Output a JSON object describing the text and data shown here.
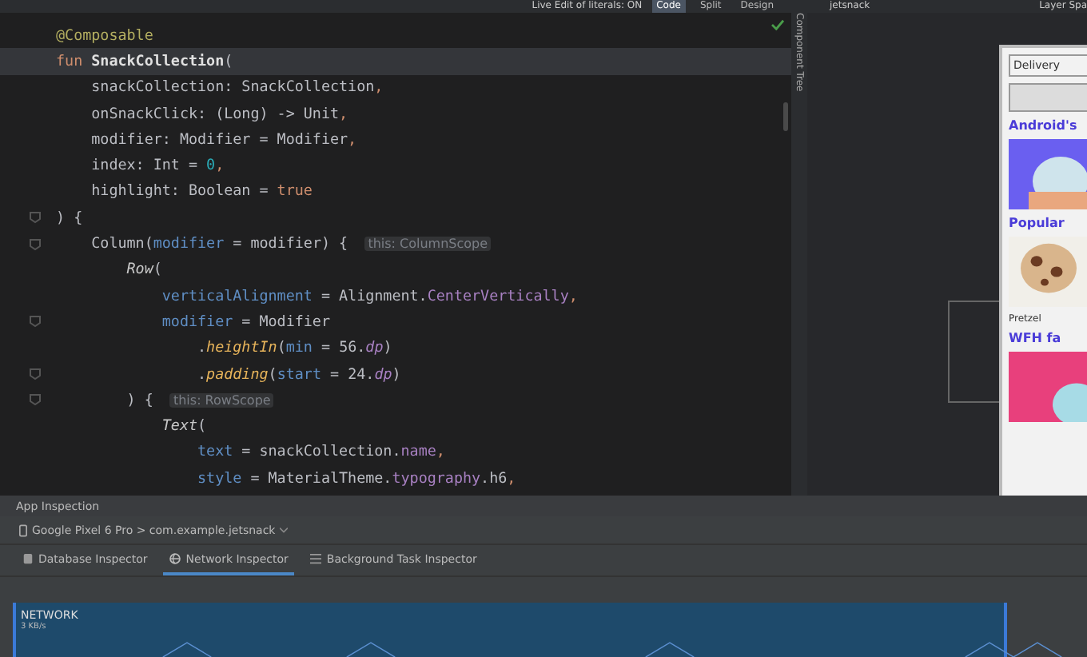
{
  "toolbar": {
    "live_edit": "Live Edit of literals: ON",
    "view_modes": [
      {
        "label": "Code",
        "selected": true
      },
      {
        "label": "Split",
        "selected": false
      },
      {
        "label": "Design",
        "selected": false
      }
    ],
    "device": "jetsnack",
    "layer_label": "Layer Spa"
  },
  "editor": {
    "lines": [
      {
        "fold": false,
        "current": false,
        "tokens": [
          {
            "kind": "annotation",
            "text": "@Composable"
          }
        ]
      },
      {
        "fold": false,
        "current": true,
        "tokens": [
          {
            "kind": "keyword",
            "text": "fun "
          },
          {
            "kind": "decl",
            "text": "SnackCollection"
          },
          {
            "kind": "plain",
            "text": "("
          }
        ]
      },
      {
        "fold": false,
        "current": false,
        "tokens": [
          {
            "kind": "plain",
            "text": "    snackCollection: SnackCollection"
          },
          {
            "kind": "keyword",
            "text": ","
          }
        ]
      },
      {
        "fold": false,
        "current": false,
        "tokens": [
          {
            "kind": "plain",
            "text": "    onSnackClick: (Long) -> Unit"
          },
          {
            "kind": "keyword",
            "text": ","
          }
        ]
      },
      {
        "fold": false,
        "current": false,
        "tokens": [
          {
            "kind": "plain",
            "text": "    modifier: Modifier = Modifier"
          },
          {
            "kind": "keyword",
            "text": ","
          }
        ]
      },
      {
        "fold": false,
        "current": false,
        "tokens": [
          {
            "kind": "plain",
            "text": "    index: Int = "
          },
          {
            "kind": "number",
            "text": "0"
          },
          {
            "kind": "keyword",
            "text": ","
          }
        ]
      },
      {
        "fold": false,
        "current": false,
        "tokens": [
          {
            "kind": "plain",
            "text": "    highlight: Boolean = "
          },
          {
            "kind": "keyword",
            "text": "true"
          }
        ]
      },
      {
        "fold": true,
        "current": false,
        "tokens": [
          {
            "kind": "plain",
            "text": ") {"
          }
        ]
      },
      {
        "fold": true,
        "current": false,
        "tokens": [
          {
            "kind": "plain",
            "text": "    Column("
          },
          {
            "kind": "param",
            "text": "modifier"
          },
          {
            "kind": "plain",
            "text": " = modifier) { "
          },
          {
            "kind": "hint",
            "text": "this: ColumnScope"
          }
        ]
      },
      {
        "fold": false,
        "current": false,
        "tokens": [
          {
            "kind": "call",
            "text": "        Row"
          },
          {
            "kind": "plain",
            "text": "("
          }
        ]
      },
      {
        "fold": false,
        "current": false,
        "tokens": [
          {
            "kind": "param",
            "text": "            verticalAlignment"
          },
          {
            "kind": "plain",
            "text": " = Alignment."
          },
          {
            "kind": "prop",
            "text": "CenterVertically"
          },
          {
            "kind": "keyword",
            "text": ","
          }
        ]
      },
      {
        "fold": true,
        "current": false,
        "tokens": [
          {
            "kind": "param",
            "text": "            modifier"
          },
          {
            "kind": "plain",
            "text": " = Modifier"
          }
        ]
      },
      {
        "fold": false,
        "current": false,
        "tokens": [
          {
            "kind": "plain",
            "text": "                ."
          },
          {
            "kind": "ext",
            "text": "heightIn"
          },
          {
            "kind": "plain",
            "text": "("
          },
          {
            "kind": "param",
            "text": "min"
          },
          {
            "kind": "plain",
            "text": " = 56."
          },
          {
            "kind": "unit",
            "text": "dp"
          },
          {
            "kind": "plain",
            "text": ")"
          }
        ]
      },
      {
        "fold": true,
        "current": false,
        "tokens": [
          {
            "kind": "plain",
            "text": "                ."
          },
          {
            "kind": "ext",
            "text": "padding"
          },
          {
            "kind": "plain",
            "text": "("
          },
          {
            "kind": "param",
            "text": "start"
          },
          {
            "kind": "plain",
            "text": " = 24."
          },
          {
            "kind": "unit",
            "text": "dp"
          },
          {
            "kind": "plain",
            "text": ")"
          }
        ]
      },
      {
        "fold": true,
        "current": false,
        "tokens": [
          {
            "kind": "plain",
            "text": "        ) { "
          },
          {
            "kind": "hint",
            "text": "this: RowScope"
          }
        ]
      },
      {
        "fold": false,
        "current": false,
        "tokens": [
          {
            "kind": "call",
            "text": "            Text"
          },
          {
            "kind": "plain",
            "text": "("
          }
        ]
      },
      {
        "fold": false,
        "current": false,
        "tokens": [
          {
            "kind": "param",
            "text": "                text"
          },
          {
            "kind": "plain",
            "text": " = snackCollection."
          },
          {
            "kind": "prop",
            "text": "name"
          },
          {
            "kind": "keyword",
            "text": ","
          }
        ]
      },
      {
        "fold": false,
        "current": false,
        "tokens": [
          {
            "kind": "param",
            "text": "                style"
          },
          {
            "kind": "plain",
            "text": " = MaterialTheme."
          },
          {
            "kind": "prop",
            "text": "typography"
          },
          {
            "kind": "plain",
            "text": ".h6"
          },
          {
            "kind": "keyword",
            "text": ","
          }
        ]
      }
    ]
  },
  "side_tab": "Component Tree",
  "layout_preview": {
    "labels": [
      "Delivery",
      "Android's",
      "Popular",
      "Pretzel",
      "WFH fa"
    ]
  },
  "app_inspection": {
    "title": "App Inspection",
    "process": "Google Pixel 6 Pro > com.example.jetsnack",
    "tabs": [
      {
        "label": "Database Inspector",
        "selected": false,
        "kind": "database"
      },
      {
        "label": "Network Inspector",
        "selected": true,
        "kind": "network"
      },
      {
        "label": "Background Task Inspector",
        "selected": false,
        "kind": "tasks"
      }
    ],
    "network": {
      "title": "NETWORK",
      "rate": "3 KB/s"
    }
  }
}
